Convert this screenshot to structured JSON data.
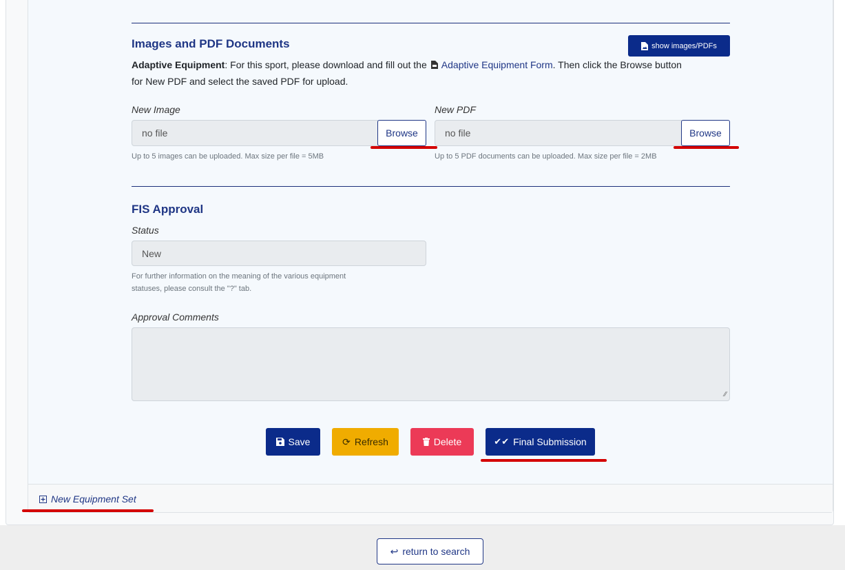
{
  "images_section": {
    "title": "Images and PDF Documents",
    "show_button_label": "show images/PDFs",
    "instructions": {
      "bold": "Adaptive Equipment",
      "before_link": ": For this sport, please download and fill out the",
      "link_text": "Adaptive Equipment Form",
      "after_link": ". Then click the Browse button",
      "line2": "for New PDF and select the saved PDF for upload."
    },
    "new_image": {
      "label": "New Image",
      "value": "no file",
      "browse_label": "Browse",
      "help": "Up to 5 images can be uploaded. Max size per file = 5MB"
    },
    "new_pdf": {
      "label": "New PDF",
      "value": "no file",
      "browse_label": "Browse",
      "help": "Up to 5 PDF documents can be uploaded. Max size per file = 2MB"
    }
  },
  "fis_section": {
    "title": "FIS Approval",
    "status_label": "Status",
    "status_value": "New",
    "status_help_1": "For further information on the meaning of the various equipment",
    "status_help_2": "statuses, please consult the \"?\" tab.",
    "comments_label": "Approval Comments",
    "comments_value": ""
  },
  "actions": {
    "save": "Save",
    "refresh": "Refresh",
    "delete": "Delete",
    "final_submission": "Final Submission"
  },
  "new_equipment_set": "New Equipment Set",
  "return_to_search": "return to search",
  "colors": {
    "primary": "#0b2b8a",
    "warning": "#f0ac00",
    "danger": "#ec3a57",
    "annotation_red": "#d40000"
  }
}
